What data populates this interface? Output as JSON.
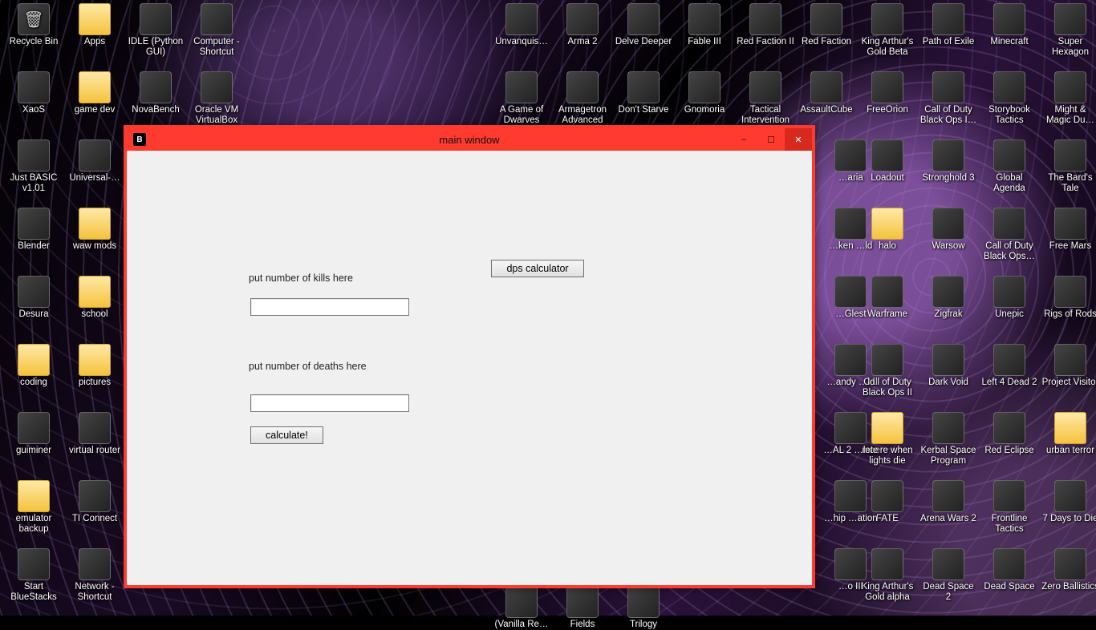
{
  "window": {
    "title": "main window",
    "app_icon_letter": "B",
    "labels": {
      "kills": "put number of kills here",
      "deaths": "put number of deaths here"
    },
    "inputs": {
      "kills": "",
      "deaths": ""
    },
    "buttons": {
      "dps": "dps calculator",
      "calculate": "calculate!"
    },
    "controls": {
      "minimize": "–",
      "maximize": "☐",
      "close": "✕"
    }
  },
  "desktop_icons": {
    "col1": [
      {
        "label": "Recycle Bin",
        "kind": "bin"
      },
      {
        "label": "XaoS",
        "kind": "app"
      },
      {
        "label": "Just BASIC v1.01",
        "kind": "app"
      },
      {
        "label": "Blender",
        "kind": "app"
      },
      {
        "label": "Desura",
        "kind": "app"
      },
      {
        "label": "coding",
        "kind": "folder"
      },
      {
        "label": "guiminer",
        "kind": "app"
      },
      {
        "label": "emulator backup",
        "kind": "folder"
      },
      {
        "label": "Start BlueStacks",
        "kind": "app"
      }
    ],
    "col2": [
      {
        "label": "Apps",
        "kind": "folder"
      },
      {
        "label": "game dev",
        "kind": "folder"
      },
      {
        "label": "Universal-…",
        "kind": "app"
      },
      {
        "label": "waw mods",
        "kind": "folder"
      },
      {
        "label": "school",
        "kind": "folder"
      },
      {
        "label": "pictures",
        "kind": "folder"
      },
      {
        "label": "virtual router",
        "kind": "app"
      },
      {
        "label": "TI Connect",
        "kind": "app"
      },
      {
        "label": "Network - Shortcut",
        "kind": "app"
      }
    ],
    "col3": [
      {
        "label": "IDLE (Python GUI)",
        "kind": "app"
      },
      {
        "label": "NovaBench",
        "kind": "app"
      }
    ],
    "col4": [
      {
        "label": "Computer - Shortcut",
        "kind": "app"
      },
      {
        "label": "Oracle VM VirtualBox",
        "kind": "app"
      }
    ],
    "col9": [
      {
        "label": "Unvanquis…",
        "kind": "app"
      },
      {
        "label": "A Game of Dwarves",
        "kind": "app"
      }
    ],
    "col10": [
      {
        "label": "Arma 2",
        "kind": "app"
      },
      {
        "label": "Armagetron Advanced",
        "kind": "app"
      }
    ],
    "col11": [
      {
        "label": "Delve Deeper",
        "kind": "app"
      },
      {
        "label": "Don't Starve",
        "kind": "app"
      }
    ],
    "col12": [
      {
        "label": "Fable III",
        "kind": "app"
      },
      {
        "label": "Gnomoria",
        "kind": "app"
      }
    ],
    "col13": [
      {
        "label": "Red Faction II",
        "kind": "app"
      },
      {
        "label": "Tactical Intervention",
        "kind": "app"
      }
    ],
    "col14": [
      {
        "label": "Red Faction",
        "kind": "app"
      },
      {
        "label": "AssaultCube",
        "kind": "app"
      }
    ],
    "col15_full": [
      {
        "label": "King Arthur's Gold Beta",
        "kind": "app"
      },
      {
        "label": "FreeOrion",
        "kind": "app"
      },
      {
        "label": "Loadout",
        "kind": "app"
      },
      {
        "label": "halo",
        "kind": "folder"
      },
      {
        "label": "Warframe",
        "kind": "app"
      },
      {
        "label": "Call of Duty Black Ops II",
        "kind": "app"
      },
      {
        "label": "maere when lights die",
        "kind": "folder"
      },
      {
        "label": "FATE",
        "kind": "app"
      },
      {
        "label": "King Arthur's Gold alpha",
        "kind": "app"
      }
    ],
    "col16_full": [
      {
        "label": "Path of Exile",
        "kind": "app"
      },
      {
        "label": "Call of Duty Black Ops I…",
        "kind": "app"
      },
      {
        "label": "Stronghold 3",
        "kind": "app"
      },
      {
        "label": "Warsow",
        "kind": "app"
      },
      {
        "label": "Zigfrak",
        "kind": "app"
      },
      {
        "label": "Dark Void",
        "kind": "app"
      },
      {
        "label": "Kerbal Space Program",
        "kind": "app"
      },
      {
        "label": "Arena Wars 2",
        "kind": "app"
      },
      {
        "label": "Dead Space 2",
        "kind": "app"
      }
    ],
    "col17_full": [
      {
        "label": "Minecraft",
        "kind": "app"
      },
      {
        "label": "Storybook Tactics",
        "kind": "app"
      },
      {
        "label": "Global Agenda",
        "kind": "app"
      },
      {
        "label": "Call of Duty Black Ops…",
        "kind": "app"
      },
      {
        "label": "Unepic",
        "kind": "app"
      },
      {
        "label": "Left 4 Dead 2",
        "kind": "app"
      },
      {
        "label": "Red Eclipse",
        "kind": "app"
      },
      {
        "label": "Frontline Tactics",
        "kind": "app"
      },
      {
        "label": "Dead Space",
        "kind": "app"
      }
    ],
    "col18_full": [
      {
        "label": "Super Hexagon",
        "kind": "app"
      },
      {
        "label": "Might & Magic Du…",
        "kind": "app"
      },
      {
        "label": "The Bard's Tale",
        "kind": "app"
      },
      {
        "label": "Free Mars",
        "kind": "app"
      },
      {
        "label": "Rigs of Rods",
        "kind": "app"
      },
      {
        "label": "Project Visitor",
        "kind": "app"
      },
      {
        "label": "urban terror",
        "kind": "folder"
      },
      {
        "label": "7 Days to Die",
        "kind": "app"
      },
      {
        "label": "Zero Ballistics",
        "kind": "app"
      }
    ],
    "partial_col_right_of_window": [
      {
        "label": "…aria",
        "kind": "app"
      },
      {
        "label": "…ken …ld",
        "kind": "app"
      },
      {
        "label": "…Glest",
        "kind": "app"
      },
      {
        "label": "…andy …ld",
        "kind": "app"
      },
      {
        "label": "…AL 2 …lete",
        "kind": "app"
      },
      {
        "label": "…hip …ation",
        "kind": "app"
      },
      {
        "label": "…o III",
        "kind": "app"
      }
    ],
    "bottom_peek": [
      {
        "label": "(Vanilla Re…",
        "kind": "app"
      },
      {
        "label": "Fields",
        "kind": "app"
      },
      {
        "label": "Trilogy",
        "kind": "app"
      }
    ]
  }
}
